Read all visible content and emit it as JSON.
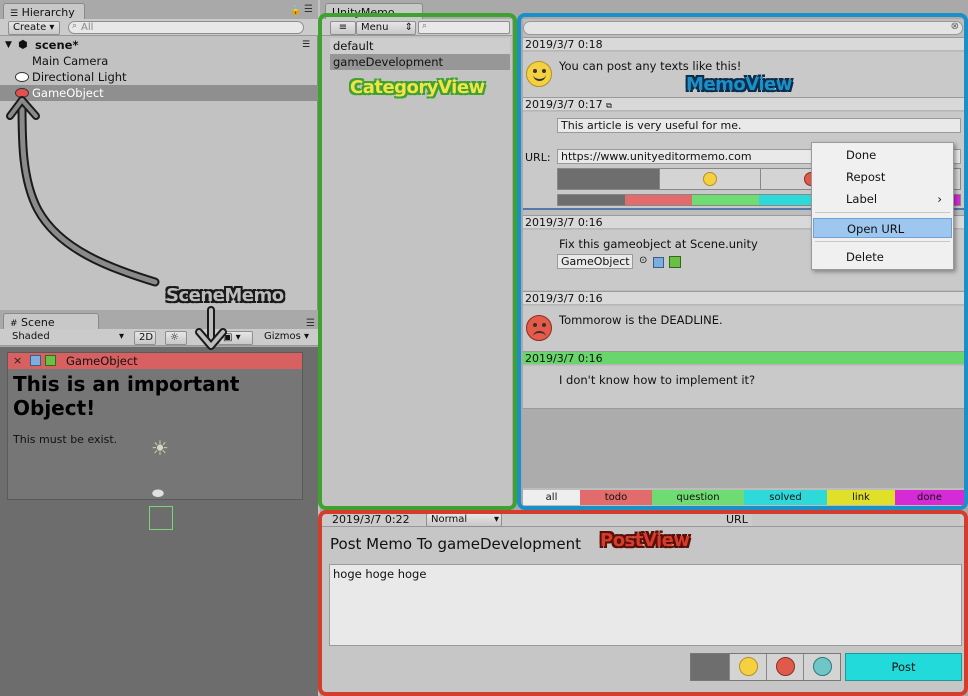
{
  "hierarchy": {
    "tab_label": "Hierarchy",
    "create_label": "Create",
    "search_placeholder": "All",
    "scene_name": "scene*",
    "items": [
      "Main Camera",
      "Directional Light",
      "GameObject"
    ]
  },
  "scene_panel": {
    "tab_label": "Scene",
    "shading_mode": "Shaded",
    "mode_2d": "2D",
    "gizmos_label": "Gizmos",
    "memo_title": "GameObject",
    "memo_heading": "This is an important Object!",
    "memo_body": "This must be exist."
  },
  "unity_memo": {
    "tab_label": "UnityMemo",
    "menu_label": "Menu",
    "categories": [
      "default",
      "gameDevelopment"
    ],
    "selected_category": "gameDevelopment",
    "memos": [
      {
        "date": "2019/3/7 0:18",
        "text": "You can post any texts like this!",
        "face": "happy"
      },
      {
        "date": "2019/3/7 0:17",
        "text": "This article is very useful for me.",
        "url_label": "URL:",
        "url": "https://www.unityeditormemo.com"
      },
      {
        "date": "2019/3/7 0:16",
        "text": "Fix this gameobject at Scene.unity",
        "object_ref": "GameObject"
      },
      {
        "date": "2019/3/7 0:16",
        "text": "Tommorow is the DEADLINE.",
        "face": "sad"
      },
      {
        "date": "2019/3/7 0:16",
        "text": "I don't know how to implement it?",
        "highlight": "question"
      }
    ],
    "context_menu": [
      "Done",
      "Repost",
      "Label",
      "Open URL",
      "Delete"
    ],
    "context_menu_selected": "Open URL",
    "tag_tabs": [
      {
        "label": "all",
        "color": "#eeeeee"
      },
      {
        "label": "todo",
        "color": "#e26b6b"
      },
      {
        "label": "question",
        "color": "#6fdc73"
      },
      {
        "label": "solved",
        "color": "#2ed9d9"
      },
      {
        "label": "link",
        "color": "#e0e02a"
      },
      {
        "label": "done",
        "color": "#d52ad5"
      }
    ]
  },
  "post_view": {
    "date": "2019/3/7 0:22",
    "label_select": "Normal",
    "url_label": "URL",
    "title": "Post Memo To gameDevelopment",
    "body": "hoge hoge hoge",
    "post_button": "Post"
  },
  "annotations": {
    "category_view": "CategoryView",
    "memo_view": "MemoView",
    "scene_memo": "SceneMemo",
    "post_view": "PostView"
  },
  "colors": {
    "category_frame": "#3fa12f",
    "memo_frame": "#1b8fc8",
    "post_frame": "#d43c2c",
    "selection": "#9ec7ef"
  }
}
